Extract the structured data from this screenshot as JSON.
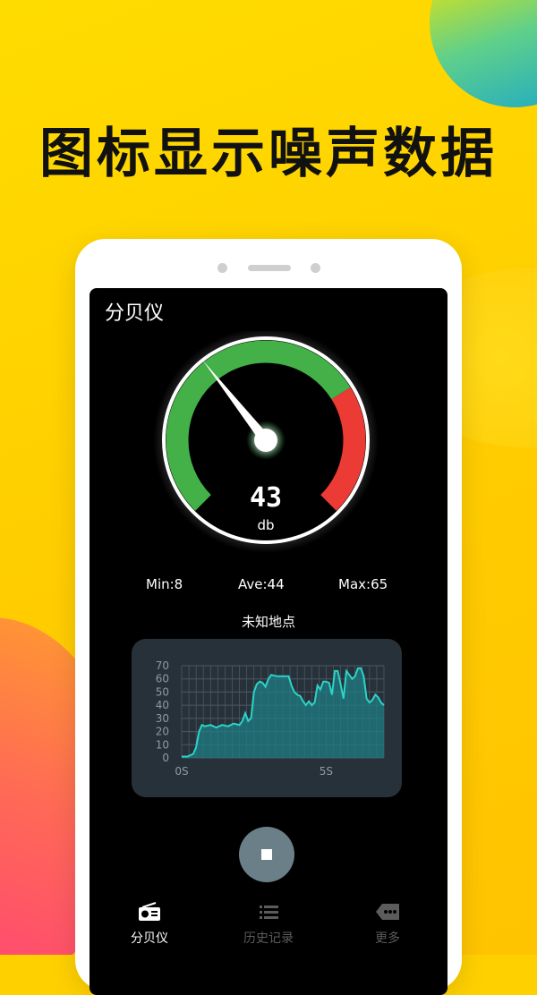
{
  "headline": "图标显示噪声数据",
  "app": {
    "title": "分贝仪"
  },
  "gauge": {
    "value": "43",
    "unit": "db",
    "needle_db": 43
  },
  "stats": {
    "min": "Min:8",
    "ave": "Ave:44",
    "max": "Max:65"
  },
  "location": "未知地点",
  "chart_data": {
    "type": "area",
    "y_ticks": [
      "70",
      "60",
      "50",
      "40",
      "30",
      "20",
      "10",
      "0"
    ],
    "x_ticks": [
      "0S",
      "5S"
    ],
    "ylim": [
      0,
      70
    ],
    "xlim": [
      0,
      7
    ],
    "grid": true,
    "x": [
      0,
      0.2,
      0.4,
      0.5,
      0.6,
      0.7,
      0.8,
      1.0,
      1.2,
      1.4,
      1.6,
      1.8,
      2.0,
      2.1,
      2.2,
      2.3,
      2.4,
      2.5,
      2.6,
      2.7,
      2.8,
      2.9,
      3.0,
      3.1,
      3.3,
      3.5,
      3.7,
      3.8,
      3.9,
      4.0,
      4.1,
      4.2,
      4.3,
      4.4,
      4.5,
      4.6,
      4.7,
      4.8,
      4.9,
      5.0,
      5.1,
      5.2,
      5.3,
      5.4,
      5.5,
      5.6,
      5.7,
      5.8,
      5.9,
      6.0,
      6.1,
      6.2,
      6.3,
      6.4,
      6.5,
      6.6,
      6.7,
      6.8,
      6.9,
      7.0
    ],
    "y": [
      1,
      1,
      3,
      8,
      20,
      25,
      24,
      25,
      23,
      25,
      24,
      26,
      25,
      28,
      34,
      28,
      30,
      50,
      56,
      58,
      57,
      54,
      60,
      63,
      62,
      62,
      62,
      55,
      50,
      48,
      47,
      43,
      40,
      43,
      40,
      42,
      55,
      52,
      58,
      58,
      57,
      48,
      66,
      66,
      56,
      45,
      66,
      63,
      60,
      62,
      68,
      68,
      62,
      45,
      42,
      44,
      48,
      46,
      42,
      40
    ],
    "line_color": "#2bd3c6",
    "fill_color": "#1f7c83"
  },
  "controls": {
    "stop_icon": "stop-square-icon"
  },
  "nav": [
    {
      "label": "分贝仪",
      "icon": "radio-icon",
      "active": true
    },
    {
      "label": "历史记录",
      "icon": "list-icon",
      "active": false
    },
    {
      "label": "更多",
      "icon": "more-tag-icon",
      "active": false
    }
  ],
  "colors": {
    "gauge_green": "#43b048",
    "gauge_red": "#ec3b35",
    "needle": "#ffffff",
    "nav_active": "#ffffff",
    "nav_inactive": "#5c5c5c"
  }
}
